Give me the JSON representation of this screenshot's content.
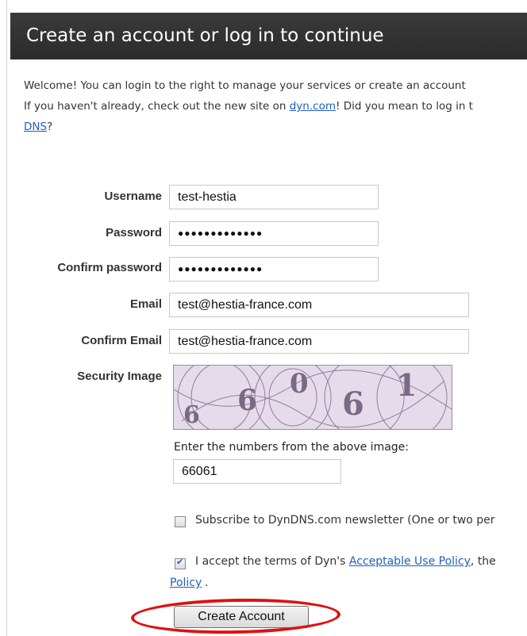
{
  "header": {
    "title": "Create an account or log in to continue"
  },
  "intro": {
    "line1": "Welcome! You can login to the right to manage your services or create an account",
    "line2_before": "If you haven't already, check out the new site on ",
    "line2_link": "dyn.com",
    "line2_after": "! Did you mean to log in t",
    "line3_link": "DNS",
    "line3_after": "?"
  },
  "form": {
    "username_label": "Username",
    "username_value": "test-hestia",
    "password_label": "Password",
    "password_value": "●●●●●●●●●●●●●",
    "confirm_password_label": "Confirm password",
    "confirm_password_value": "●●●●●●●●●●●●●",
    "email_label": "Email",
    "email_value": "test@hestia-france.com",
    "confirm_email_label": "Confirm Email",
    "confirm_email_value": "test@hestia-france.com",
    "security_image_label": "Security Image",
    "captcha_digits": [
      "6",
      "6",
      "0",
      "6",
      "1"
    ],
    "captcha_prompt": "Enter the numbers from the above image:",
    "captcha_value": "66061"
  },
  "options": {
    "newsletter_label": "Subscribe to DynDNS.com newsletter (One or two per",
    "newsletter_checked": false,
    "terms_before": "I accept the terms of Dyn's ",
    "terms_link": "Acceptable Use Policy",
    "terms_after": ", the",
    "terms_checked": true,
    "policy_link": "Policy",
    "policy_after": "."
  },
  "submit": {
    "label": "Create Account"
  },
  "colors": {
    "header_bg": "#2b2b2b",
    "link": "#1f5fbf",
    "highlight_ring": "#e01010"
  }
}
